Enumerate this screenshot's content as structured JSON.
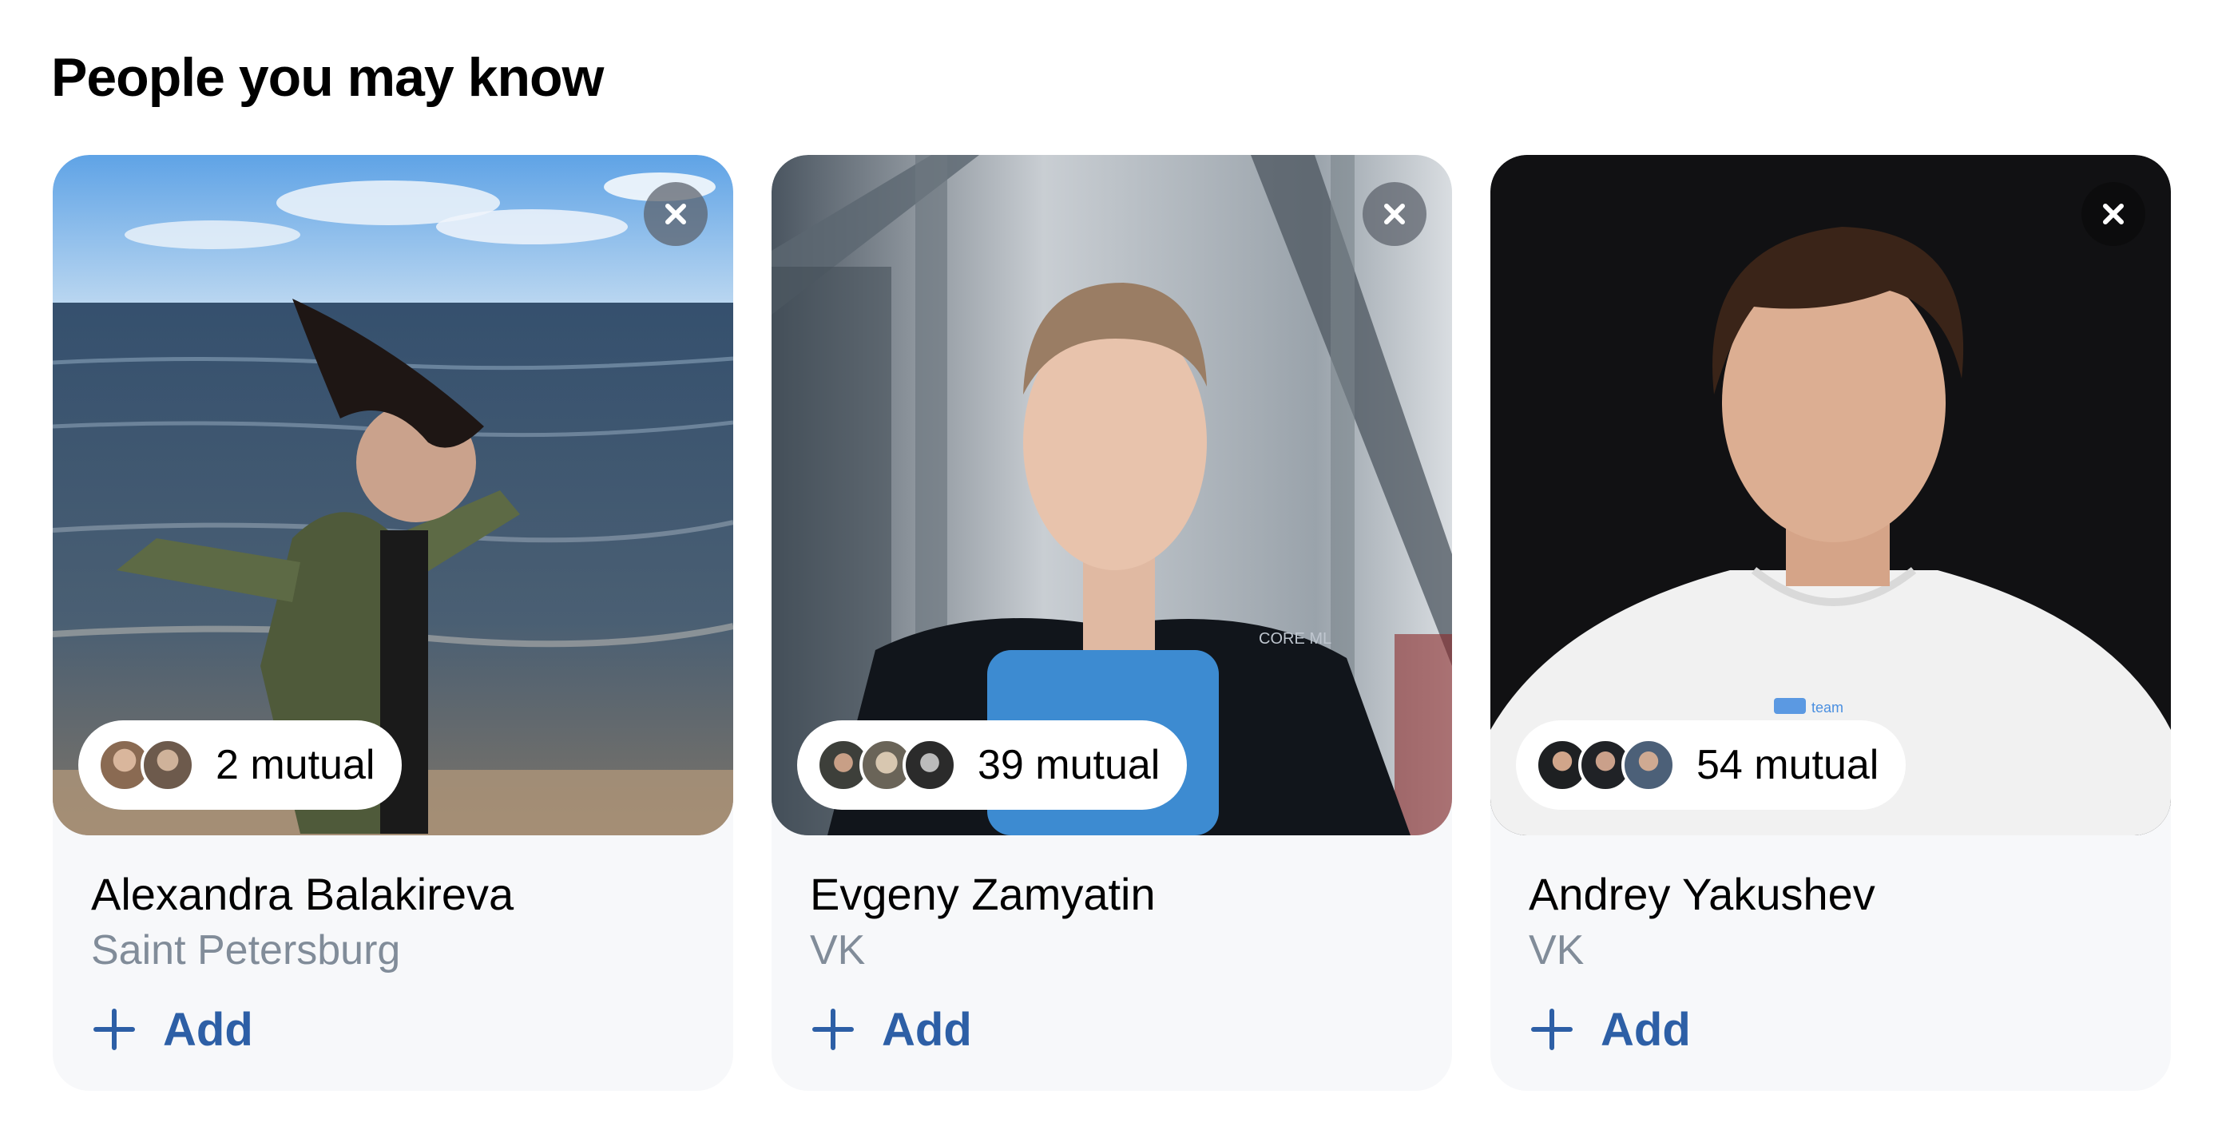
{
  "section": {
    "title": "People you may know"
  },
  "cards": [
    {
      "name": "Alexandra Balakireva",
      "subtitle": "Saint Petersburg",
      "mutual": "2 mutual",
      "add_label": "Add",
      "close_icon": "close-icon",
      "add_icon": "plus-icon"
    },
    {
      "name": "Evgeny Zamyatin",
      "subtitle": "VK",
      "mutual": "39 mutual",
      "add_label": "Add",
      "close_icon": "close-icon",
      "add_icon": "plus-icon"
    },
    {
      "name": "Andrey Yakushev",
      "subtitle": "VK",
      "mutual": "54 mutual",
      "add_label": "Add",
      "close_icon": "close-icon",
      "add_icon": "plus-icon"
    }
  ],
  "colors": {
    "accent": "#2d5fa6",
    "subtitle": "#818c99",
    "card_bg": "#f7f8fa"
  }
}
